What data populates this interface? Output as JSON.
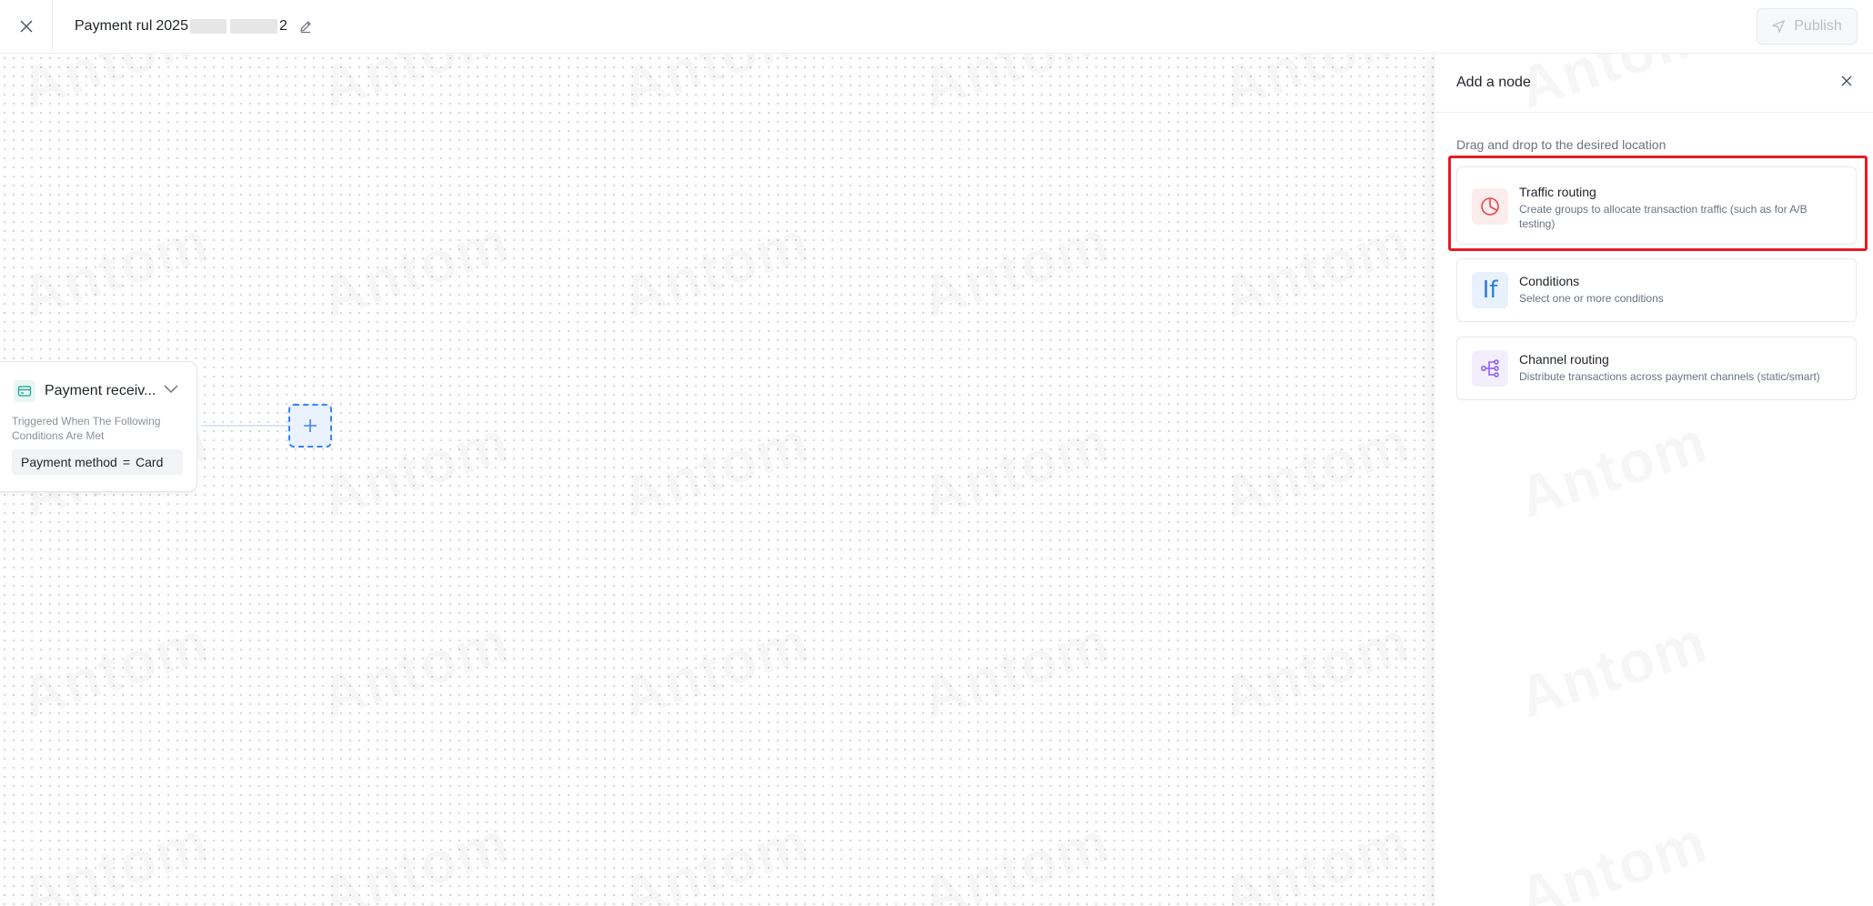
{
  "header": {
    "title_start": "Payment rul",
    "title_mid": "2025",
    "title_end": "2",
    "publish_label": "Publish"
  },
  "canvas": {
    "watermark_text": "Antom",
    "node": {
      "title": "Payment receiv...",
      "description": "Triggered When The Following Conditions Are Met",
      "condition_field": "Payment method",
      "condition_operator": "=",
      "condition_value": "Card"
    }
  },
  "panel": {
    "title": "Add a node",
    "hint": "Drag and drop to the desired location",
    "options": [
      {
        "title": "Traffic routing",
        "description": "Create groups to allocate transaction traffic (such as for A/B testing)",
        "icon": "pie-chart-icon",
        "color": "#e5484d"
      },
      {
        "title": "Conditions",
        "description": "Select one or more conditions",
        "icon": "if-icon",
        "icon_text": "If",
        "color": "#2f7de1"
      },
      {
        "title": "Channel routing",
        "description": "Distribute transactions across payment channels (static/smart)",
        "icon": "branch-icon",
        "color": "#8b5cf6"
      }
    ]
  },
  "colors": {
    "accent_blue": "#3b82f6",
    "highlight_red": "#e51c23",
    "node_icon_teal": "#16a394"
  }
}
